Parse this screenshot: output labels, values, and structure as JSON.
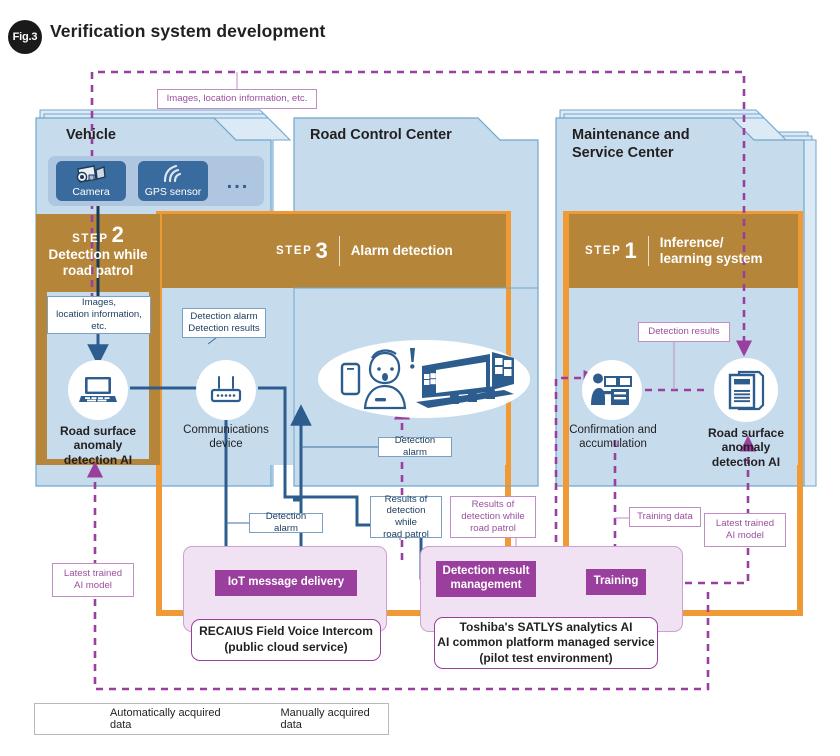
{
  "figure": {
    "badge": "Fig.3",
    "title": "Verification system development"
  },
  "colors": {
    "panel_fill": "#c6dced",
    "panel_stroke": "#6fa6ce",
    "step_band": "#b5853a",
    "orange_frame": "#ef9a35",
    "blue_arrow": "#2d5d8e",
    "purple_arrow": "#9b3f9e",
    "purple_group_fill": "#f0e2f2",
    "purple_chip": "#9b3f9e",
    "device_chip": "#3a6b9e",
    "icon_blue": "#2d5d8e"
  },
  "panels": [
    {
      "id": "vehicle",
      "title": "Vehicle"
    },
    {
      "id": "road_control_center",
      "title": "Road Control Center"
    },
    {
      "id": "maintenance",
      "title": "Maintenance and\nService Center"
    }
  ],
  "steps": [
    {
      "id": "step2",
      "word": "STEP",
      "number": "2",
      "label": "Detection while\nroad patrol",
      "stacked": true
    },
    {
      "id": "step3",
      "word": "STEP",
      "number": "3",
      "label": "Alarm detection",
      "stacked": false
    },
    {
      "id": "step1",
      "word": "STEP",
      "number": "1",
      "label": "Inference/\nlearning system",
      "stacked": false
    }
  ],
  "devices": [
    {
      "id": "camera",
      "label": "Camera",
      "icon": "video-camera-icon"
    },
    {
      "id": "gps",
      "label": "GPS sensor",
      "icon": "wifi-signal-icon"
    },
    {
      "id": "more",
      "label": "...",
      "icon": "ellipsis-icon"
    }
  ],
  "nodes": [
    {
      "id": "vehicle_ai",
      "caption": "Road surface\nanomaly\ndetection AI",
      "bold": true,
      "icon": "laptop-icon"
    },
    {
      "id": "comms_device",
      "caption": "Communications\ndevice",
      "bold": false,
      "icon": "router-icon"
    },
    {
      "id": "operator",
      "caption": "",
      "bold": false,
      "icon": "operator-control-room-icon"
    },
    {
      "id": "confirmation",
      "caption": "Confirmation and\naccumulation",
      "bold": false,
      "icon": "person-at-desk-icon"
    },
    {
      "id": "center_ai",
      "caption": "Road surface\nanomaly\ndetection AI",
      "bold": true,
      "icon": "documents-icon"
    }
  ],
  "callouts": [
    {
      "id": "images_loc_top",
      "text": "Images, location information, etc.",
      "style": "purple"
    },
    {
      "id": "images_loc_left",
      "text": "Images,\nlocation information,\netc.",
      "style": "blue"
    },
    {
      "id": "alarm_results",
      "text": "Detection alarm\nDetection results",
      "style": "blue"
    },
    {
      "id": "detection_alarm_center",
      "text": "Detection alarm",
      "style": "blue"
    },
    {
      "id": "detection_alarm_iot",
      "text": "Detection alarm",
      "style": "blue"
    },
    {
      "id": "results_patrol_blue",
      "text": "Results of\ndetection while\nroad patrol",
      "style": "blue"
    },
    {
      "id": "results_patrol_purple",
      "text": "Results of\ndetection while\nroad patrol",
      "style": "purple"
    },
    {
      "id": "detection_results_right",
      "text": "Detection results",
      "style": "purple"
    },
    {
      "id": "training_data",
      "text": "Training data",
      "style": "purple"
    },
    {
      "id": "latest_model_right",
      "text": "Latest trained\nAI model",
      "style": "purple"
    },
    {
      "id": "latest_model_left",
      "text": "Latest trained\nAI model",
      "style": "purple"
    }
  ],
  "services": [
    {
      "id": "recaius",
      "chip": "IoT message delivery",
      "note": "RECAIUS Field Voice Intercom\n(public cloud service)"
    },
    {
      "id": "satlys",
      "chips": [
        "Detection result\nmanagement",
        "Training"
      ],
      "note": "Toshiba's SATLYS analytics AI\nAI common platform managed service\n(pilot test environment)"
    }
  ],
  "legend": [
    {
      "id": "auto",
      "label": "Automatically acquired data",
      "style": "solid-blue-arrow"
    },
    {
      "id": "manual",
      "label": "Manually acquired data",
      "style": "dashed-purple-arrow"
    }
  ]
}
